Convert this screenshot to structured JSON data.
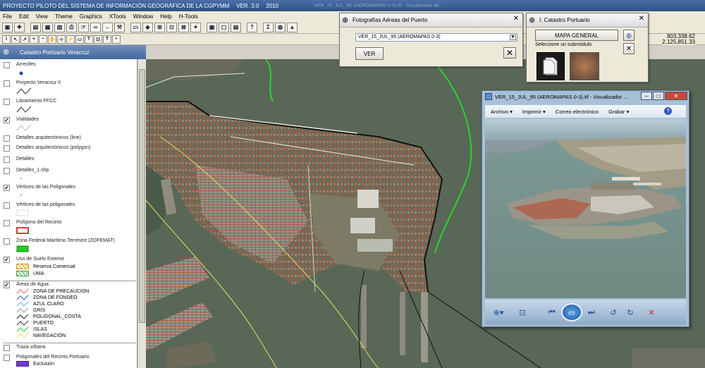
{
  "app": {
    "title": "PROYECTO PILOTO DEL SISTEMA DE INFORMACIÓN GEOGRÁFICA DE LA CGPYMM",
    "version": "VER. 3.0",
    "year": "2010",
    "faded_title": "VER_15_JUL_95 (AEROMAPAS 0-3).tif - Visualizador de ..."
  },
  "menu": [
    "File",
    "Edit",
    "View",
    "Theme",
    "Graphics",
    "XTools",
    "Window",
    "Help",
    "H-Tools"
  ],
  "toolbar1_icons": [
    "save-icon",
    "add-theme-icon",
    "table-icon",
    "chart-icon",
    "layout-icon",
    "print-icon",
    "identify-icon",
    "binoculars-icon",
    "query-icon",
    "hammer-icon",
    "select-icon",
    "view-icon",
    "zoom-full-icon",
    "zoom-extent-icon",
    "zoom-selected-icon",
    "zoom-in-icon",
    "zoom-out-icon",
    "pan-icon",
    "clear-icon",
    "help-icon",
    "sigma-icon",
    "globe-icon",
    "map-icon"
  ],
  "toolbar2_icons": [
    "info-icon",
    "pointer-icon",
    "vertex-icon",
    "zoom-in-tool-icon",
    "zoom-out-tool-icon",
    "pan-tool-icon",
    "measure-icon",
    "hotlink-icon",
    "area-icon",
    "text-tool-icon",
    "draw-icon",
    "label-icon",
    "point-icon"
  ],
  "coords": {
    "x": "803,338.62",
    "y": "2,125,851.33"
  },
  "panel": {
    "title": "Catastro Portuario Veracruz"
  },
  "layers": [
    {
      "name": "Arrecifes",
      "checked": false
    },
    {
      "name": "Proyecto Veracruz II",
      "checked": false
    },
    {
      "name": "Libramiento FFCC",
      "checked": false
    },
    {
      "name": "Vialidades",
      "checked": true
    },
    {
      "name": "Detalles arquitectónicos (line)",
      "checked": false
    },
    {
      "name": "Detalles arquitectónicos (polygon)",
      "checked": false
    },
    {
      "name": "Detalles",
      "checked": false
    },
    {
      "name": "Detalles_1.shp",
      "checked": false
    },
    {
      "name": "Vértices de las Poligonales",
      "checked": true
    },
    {
      "name": "Vértices de las poligonales",
      "checked": false
    },
    {
      "name": "Polígono del Recinto",
      "checked": false
    },
    {
      "name": "Zona Federal Marítimo Terrestre (ZOFEMAT)",
      "checked": false
    },
    {
      "name": "Uso de Suelo Exterior",
      "checked": true,
      "classes": [
        "Reserva Comercial",
        "UMA"
      ]
    },
    {
      "name": "Áreas de Agua",
      "checked": true,
      "classes": [
        "ZONA DE PRECAUCION",
        "ZONA DE FONDEO",
        "AZUL CLARO",
        "GRIS",
        "POLIGONAL_COSTA",
        "PUERTO",
        "ISLAS",
        "NAVEGACION"
      ]
    },
    {
      "name": "Traza urbana",
      "checked": false
    },
    {
      "name": "Poligonales del Recinto Portuario",
      "checked": false,
      "classes": [
        "Exclusión"
      ]
    }
  ],
  "photo_dialog": {
    "title": "Fotografías Aéreas del Puerto",
    "selected": "VER_15_JUL_95 (AEROMAPAS 0-3)",
    "ver_label": "VER"
  },
  "catastro_dialog": {
    "title": "I. Catastro Portuario",
    "mapa_label": "MAPA GENERAL",
    "submodule_label": "Seleccione un submódulo"
  },
  "viewer": {
    "title": "VER_15_JUL_95 (AEROMAPAS 0-3).tif - Visualizador ...",
    "menu": [
      "Archivo ▾",
      "Imprimir ▾",
      "Correo electrónico",
      "Grabar ▾"
    ]
  },
  "colors": {
    "title_bar": "#2f4f80",
    "panel_header": "#45679c",
    "route_green": "#2bd42b",
    "legend_red": "#c00000",
    "legend_green": "#22cc22"
  }
}
